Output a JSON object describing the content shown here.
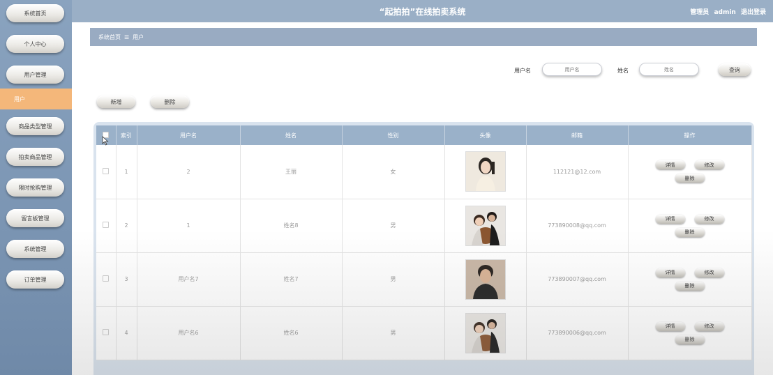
{
  "header": {
    "title": "“起拍拍”在线拍卖系统",
    "role": "管理员",
    "username": "admin",
    "logout": "退出登录"
  },
  "sidebar": {
    "items": [
      {
        "label": "系统首页"
      },
      {
        "label": "个人中心"
      },
      {
        "label": "用户管理"
      },
      {
        "label": "用户"
      },
      {
        "label": "商品类型管理"
      },
      {
        "label": "拍卖商品管理"
      },
      {
        "label": "限时抢购管理"
      },
      {
        "label": "留言板管理"
      },
      {
        "label": "系统管理"
      },
      {
        "label": "订单管理"
      }
    ],
    "active_index": 3
  },
  "breadcrumb": {
    "home": "系统首页",
    "separator": "☰",
    "current": "用户"
  },
  "search": {
    "username_label": "用户名",
    "username_placeholder": "用户名",
    "name_label": "姓名",
    "name_placeholder": "姓名",
    "button": "查询"
  },
  "actions": {
    "add": "新增",
    "delete": "删除"
  },
  "table": {
    "columns": [
      "",
      "索引",
      "用户名",
      "姓名",
      "性别",
      "头像",
      "邮箱",
      "操作"
    ],
    "op_labels": {
      "detail": "详情",
      "edit": "修改",
      "delete": "删除"
    },
    "rows": [
      {
        "index": "1",
        "username": "2",
        "name": "王丽",
        "gender": "女",
        "avatar": "photo-woman",
        "email": "112121@12.com"
      },
      {
        "index": "2",
        "username": "1",
        "name": "姓名8",
        "gender": "男",
        "avatar": "photo-couple-dog",
        "email": "773890008@qq.com"
      },
      {
        "index": "3",
        "username": "用户名7",
        "name": "姓名7",
        "gender": "男",
        "avatar": "photo-man",
        "email": "773890007@qq.com"
      },
      {
        "index": "4",
        "username": "用户名6",
        "name": "姓名6",
        "gender": "男",
        "avatar": "photo-couple-dog",
        "email": "773890006@qq.com"
      }
    ]
  },
  "colors": {
    "sidebar": "#7b95b3",
    "header": "#9aafc6",
    "active": "#f4b77a",
    "table_header": "#9ab1c9"
  }
}
